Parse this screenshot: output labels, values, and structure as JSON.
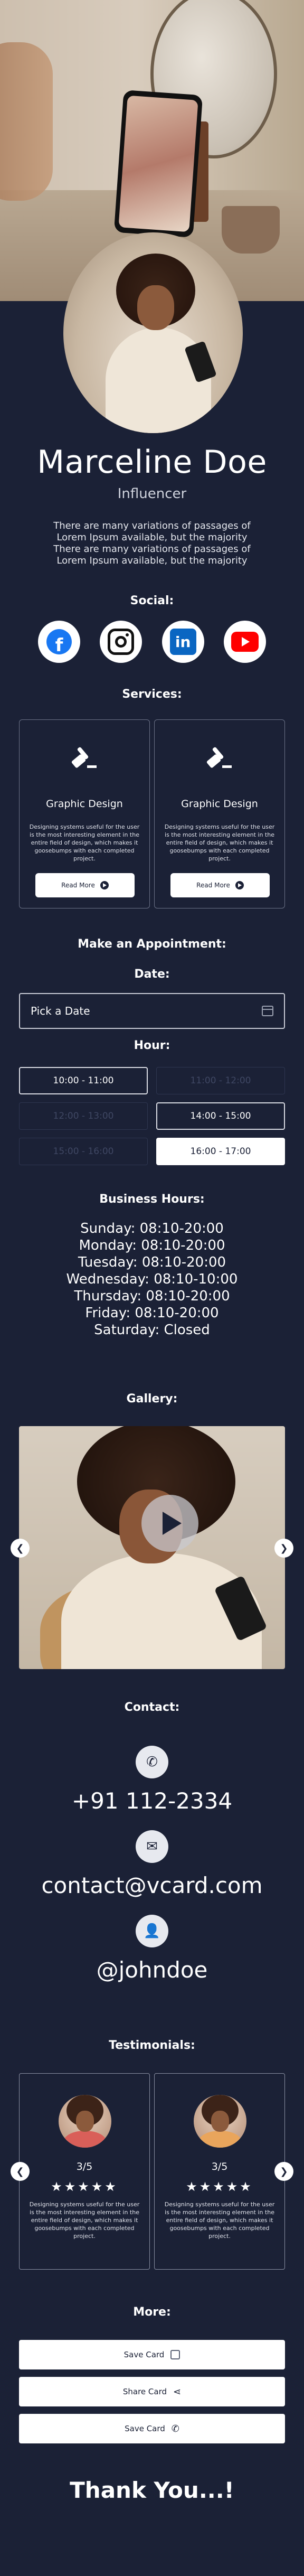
{
  "profile": {
    "name": "Marceline Doe",
    "role": "Influencer",
    "bio": "There are many variations of passages of Lorem Ipsum available, but the majority There are many variations of passages of Lorem Ipsum available, but the majority"
  },
  "social": {
    "title": "Social:",
    "items": [
      {
        "icon": "facebook-icon"
      },
      {
        "icon": "instagram-icon"
      },
      {
        "icon": "linkedin-icon"
      },
      {
        "icon": "youtube-icon"
      }
    ]
  },
  "services": {
    "title": "Services:",
    "items": [
      {
        "title": "Graphic Design",
        "description": "Designing systems useful for the user is the most interesting element in the entire field of design, which makes it goosebumps with each completed project.",
        "button": "Read More"
      },
      {
        "title": "Graphic Design",
        "description": "Designing systems useful for the user is the most interesting element in the entire field of design, which makes it goosebumps with each completed project.",
        "button": "Read More"
      }
    ]
  },
  "appointment": {
    "title": "Make an Appointment:",
    "date_label": "Date:",
    "date_placeholder": "Pick a Date",
    "hour_label": "Hour:",
    "slots": [
      {
        "label": "10:00 - 11:00",
        "state": "available"
      },
      {
        "label": "11:00 - 12:00",
        "state": "disabled"
      },
      {
        "label": "12:00 - 13:00",
        "state": "disabled"
      },
      {
        "label": "14:00 - 15:00",
        "state": "available"
      },
      {
        "label": "15:00 - 16:00",
        "state": "disabled"
      },
      {
        "label": "16:00 - 17:00",
        "state": "selected"
      }
    ]
  },
  "business_hours": {
    "title": "Business Hours:",
    "days": [
      "Sunday: 08:10-20:00",
      "Monday: 08:10-20:00",
      "Tuesday: 08:10-20:00",
      "Wednesday: 08:10-10:00",
      "Thursday: 08:10-20:00",
      "Friday: 08:10-20:00",
      "Saturday: Closed"
    ]
  },
  "gallery": {
    "title": "Gallery:"
  },
  "contact": {
    "title": "Contact:",
    "phone": "+91 112-2334",
    "email": "contact@vcard.com",
    "handle": "@johndoe"
  },
  "testimonials": {
    "title": "Testimonials:",
    "items": [
      {
        "score": "3/5",
        "stars": "★★★★★",
        "text": "Designing systems useful for the user is the most interesting element in the entire field of design, which makes it goosebumps with each completed project."
      },
      {
        "score": "3/5",
        "stars": "★★★★★",
        "text": "Designing systems useful for the user is the most interesting element in the entire field of design, which makes it goosebumps with each completed project."
      }
    ]
  },
  "more": {
    "title": "More:",
    "buttons": [
      {
        "label": "Save Card",
        "icon": "download-icon"
      },
      {
        "label": "Share Card",
        "icon": "share-icon"
      },
      {
        "label": "Save Card",
        "icon": "phone-icon"
      }
    ]
  },
  "footer": {
    "thanks": "Thank You...!"
  },
  "colors": {
    "background": "#1b2136",
    "text": "#ffffff",
    "button": "#ffffff"
  }
}
